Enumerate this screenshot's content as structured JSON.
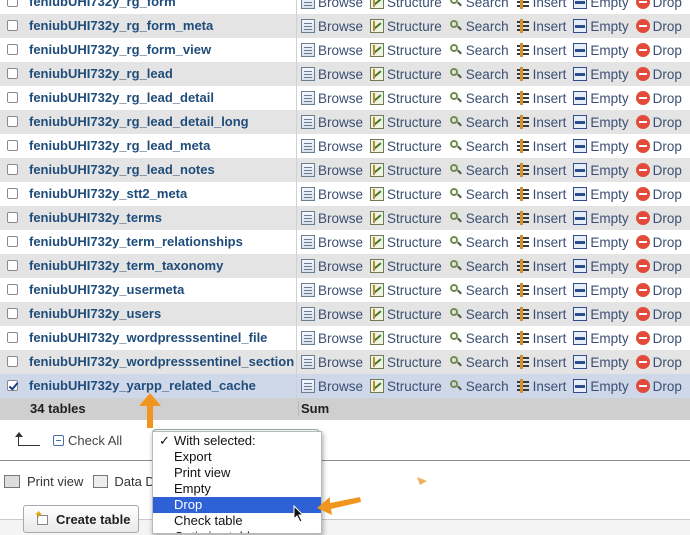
{
  "tables": [
    {
      "name": "feniubUHI732y_rg_form",
      "checked": false
    },
    {
      "name": "feniubUHI732y_rg_form_meta",
      "checked": false
    },
    {
      "name": "feniubUHI732y_rg_form_view",
      "checked": false
    },
    {
      "name": "feniubUHI732y_rg_lead",
      "checked": false
    },
    {
      "name": "feniubUHI732y_rg_lead_detail",
      "checked": false
    },
    {
      "name": "feniubUHI732y_rg_lead_detail_long",
      "checked": false
    },
    {
      "name": "feniubUHI732y_rg_lead_meta",
      "checked": false
    },
    {
      "name": "feniubUHI732y_rg_lead_notes",
      "checked": false
    },
    {
      "name": "feniubUHI732y_stt2_meta",
      "checked": false
    },
    {
      "name": "feniubUHI732y_terms",
      "checked": false
    },
    {
      "name": "feniubUHI732y_term_relationships",
      "checked": false
    },
    {
      "name": "feniubUHI732y_term_taxonomy",
      "checked": false
    },
    {
      "name": "feniubUHI732y_usermeta",
      "checked": false
    },
    {
      "name": "feniubUHI732y_users",
      "checked": false
    },
    {
      "name": "feniubUHI732y_wordpresssentinel_file",
      "checked": false
    },
    {
      "name": "feniubUHI732y_wordpresssentinel_section",
      "checked": false
    },
    {
      "name": "feniubUHI732y_yarpp_related_cache",
      "checked": true
    }
  ],
  "actions": [
    {
      "label": "Browse",
      "icon": "browse-icon"
    },
    {
      "label": "Structure",
      "icon": "structure-icon"
    },
    {
      "label": "Search",
      "icon": "search-icon"
    },
    {
      "label": "Insert",
      "icon": "insert-icon"
    },
    {
      "label": "Empty",
      "icon": "empty-icon"
    },
    {
      "label": "Drop",
      "icon": "drop-icon"
    }
  ],
  "footer": {
    "count": "34 tables",
    "sum": "Sum"
  },
  "controls": {
    "check_all": "Check All"
  },
  "with_selected": {
    "options": [
      "With selected:",
      "Export",
      "Print view",
      "Empty",
      "Drop",
      "Check table",
      "Optimize table"
    ],
    "highlighted_index": 4,
    "checked_index": 0
  },
  "links": {
    "print_view": "Print view",
    "data_dictionary": "Data D"
  },
  "create_table": {
    "label": "Create table"
  },
  "colors": {
    "accent_orange": "#f0961e",
    "highlight_blue": "#2f61d6",
    "link_blue": "#1f4c7a"
  }
}
